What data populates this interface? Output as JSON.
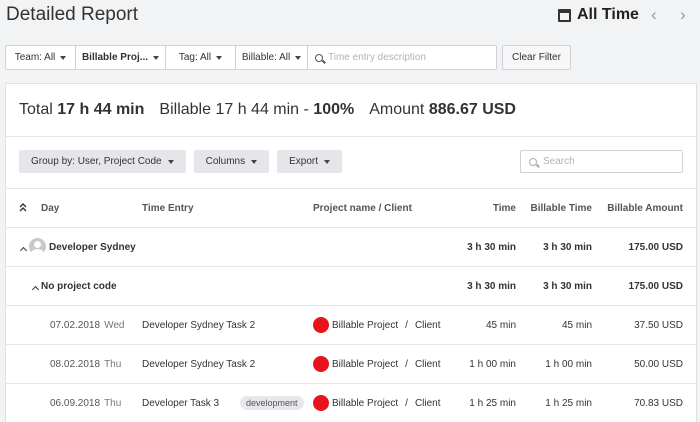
{
  "header": {
    "title": "Detailed Report",
    "range_label": "All Time",
    "prev_icon": "chevron-left-icon",
    "next_icon": "chevron-right-icon"
  },
  "filters": {
    "team": "Team: All",
    "billable_projects": "Billable Proj...",
    "tag": "Tag: All",
    "billable": "Billable: All",
    "description_placeholder": "Time entry description",
    "clear_label": "Clear Filter"
  },
  "totals": {
    "total_label": "Total",
    "total_value": "17 h 44 min",
    "billable_label": "Billable",
    "billable_value": "17 h 44 min -",
    "billable_pct": "100%",
    "amount_label": "Amount",
    "amount_value": "886.67 USD"
  },
  "toolbar": {
    "group_by": "Group by: User, Project Code",
    "columns": "Columns",
    "export": "Export",
    "search_placeholder": "Search"
  },
  "table": {
    "columns": [
      "Day",
      "Time Entry",
      "Project name / Client",
      "Time",
      "Billable Time",
      "Billable Amount"
    ],
    "group": {
      "name": "Developer Sydney",
      "time": "3 h 30 min",
      "billable_time": "3 h 30 min",
      "amount": "175.00 USD"
    },
    "subgroup": {
      "name": "No project code",
      "time": "3 h 30 min",
      "billable_time": "3 h 30 min",
      "amount": "175.00 USD"
    },
    "rows": [
      {
        "date": "07.02.2018",
        "weekday": "Wed",
        "entry": "Developer Sydney Task 2",
        "tag": "",
        "project": "Billable Project",
        "client": "Client",
        "time": "45 min",
        "billable_time": "45 min",
        "amount": "37.50 USD"
      },
      {
        "date": "08.02.2018",
        "weekday": "Thu",
        "entry": "Developer Sydney Task 2",
        "tag": "",
        "project": "Billable Project",
        "client": "Client",
        "time": "1 h 00 min",
        "billable_time": "1 h 00 min",
        "amount": "50.00 USD"
      },
      {
        "date": "06.09.2018",
        "weekday": "Thu",
        "entry": "Developer Task 3",
        "tag": "development",
        "project": "Billable Project",
        "client": "Client",
        "time": "1 h 25 min",
        "billable_time": "1 h 25 min",
        "amount": "70.83 USD"
      }
    ],
    "project_color": "#e8141b"
  },
  "colors": {
    "background": "#f2f3f5",
    "button": "#e4e6ea",
    "project_dot": "#e8141b"
  }
}
